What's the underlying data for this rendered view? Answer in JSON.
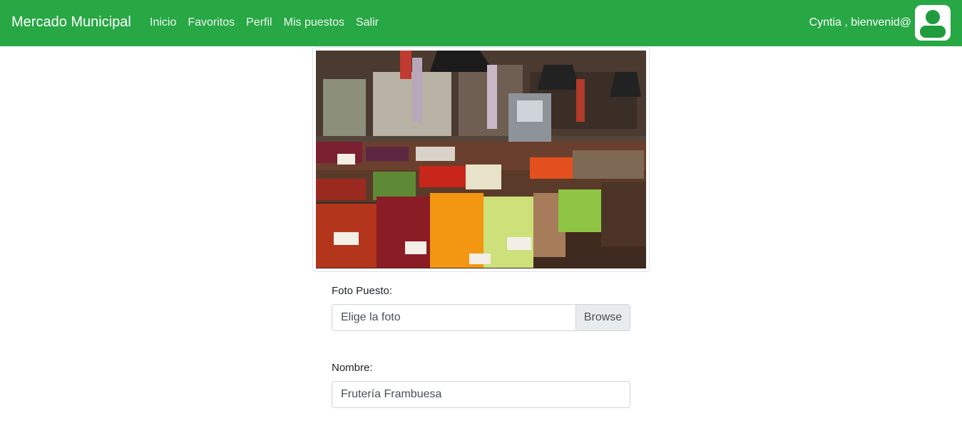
{
  "navbar": {
    "brand": "Mercado Municipal",
    "links": [
      "Inicio",
      "Favoritos",
      "Perfil",
      "Mis puestos",
      "Salir"
    ],
    "welcome": "Cyntia , bienvenid@",
    "avatar_icon": "user-avatar-icon"
  },
  "stall_photo": {
    "icon": "market-stall-photo"
  },
  "form": {
    "photo_label": "Foto Puesto:",
    "photo_placeholder": "Elige la foto",
    "browse_label": "Browse",
    "name_label": "Nombre:",
    "name_value": "Frutería Frambuesa"
  },
  "colors": {
    "navbar_bg": "#28a745",
    "avatar_accent": "#1e9c3e"
  }
}
